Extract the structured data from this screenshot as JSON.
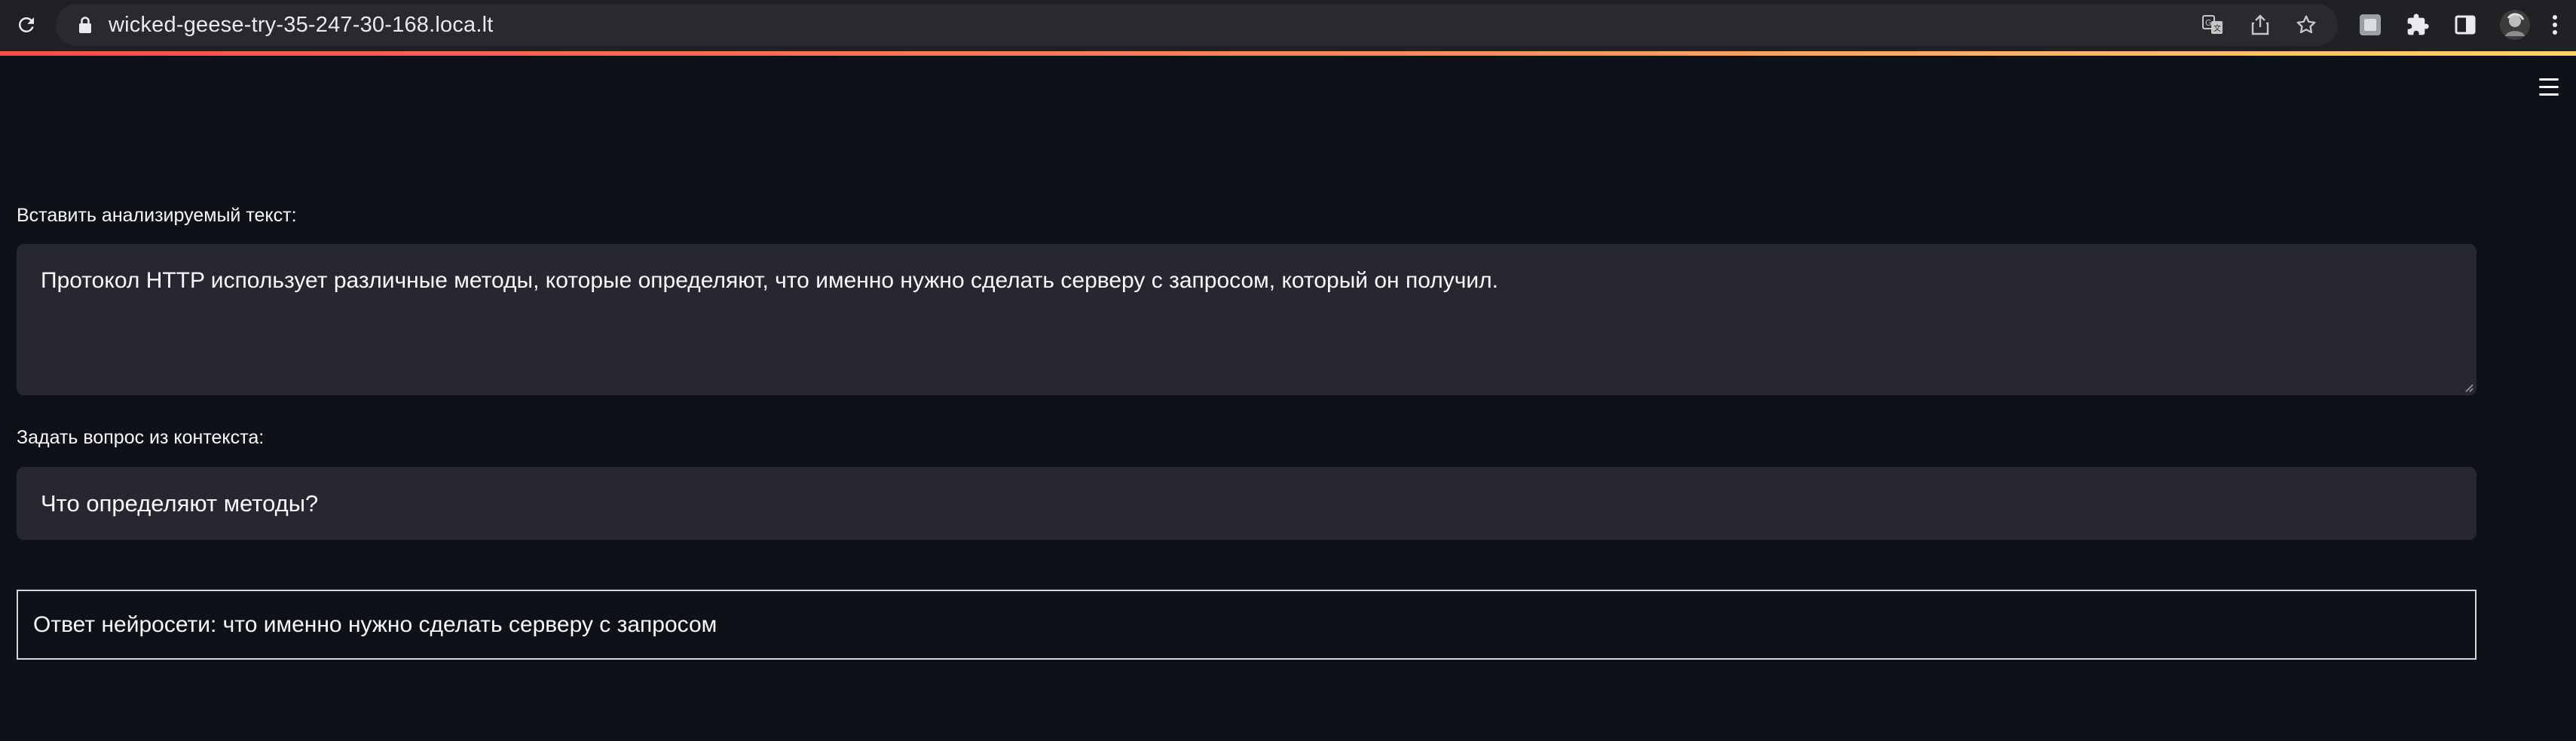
{
  "browser": {
    "url": "wicked-geese-try-35-247-30-168.loca.lt",
    "icons": {
      "reload": "reload-icon",
      "lock": "lock-icon",
      "translate": "translate-icon",
      "share": "share-icon",
      "bookmark": "star-icon",
      "extension1": "extension-icon",
      "extensions": "puzzle-icon",
      "sidepanel": "side-panel-icon",
      "profile": "avatar",
      "menu": "kebab-menu-icon"
    }
  },
  "app": {
    "menu_icon": "hamburger-menu-icon",
    "context_label": "Вставить анализируемый текст:",
    "context_value": "Протокол HTTP использует различные методы, которые определяют, что именно нужно сделать серверу с запросом, который он получил.",
    "question_label": "Задать вопрос из контекста:",
    "question_value": "Что определяют методы?",
    "answer_text": "Ответ нейросети: что именно нужно сделать серверу с запросом"
  },
  "colors": {
    "background": "#0e1117",
    "input_background": "#262730",
    "chrome_background": "#202124",
    "omnibox_background": "#282a2d",
    "accent_start": "#ff4b4b",
    "accent_end": "#ffd36b"
  }
}
